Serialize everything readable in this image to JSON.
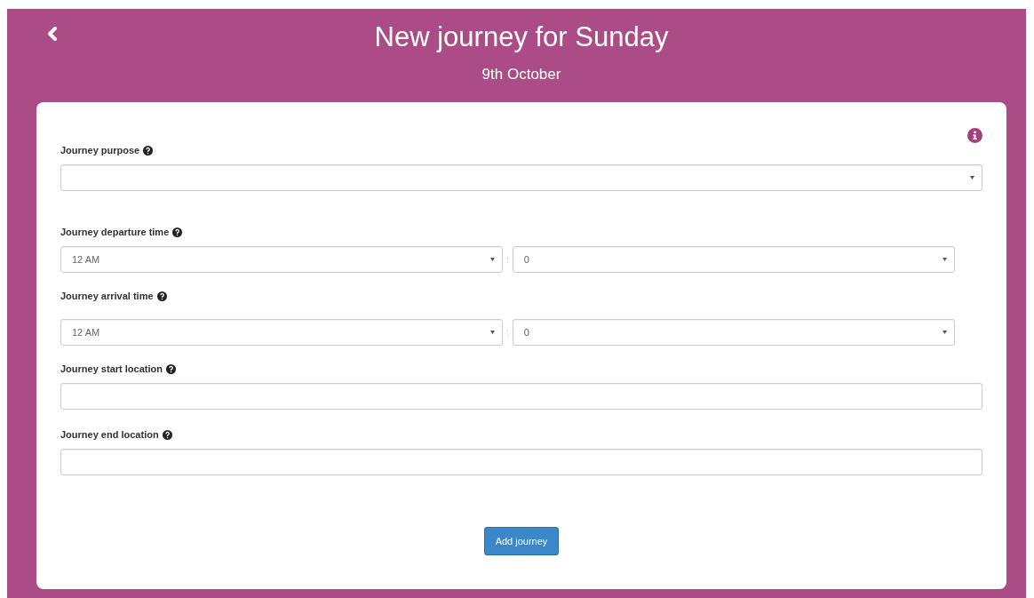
{
  "header": {
    "title": "New journey for Sunday",
    "subtitle": "9th October"
  },
  "fields": [
    {
      "kind": "select",
      "label": "Journey purpose"
    },
    {
      "kind": "time",
      "label": "Journey departure time",
      "hour": "12 AM",
      "separator": ":",
      "minute": "0"
    },
    {
      "kind": "time",
      "label": "Journey arrival time",
      "hour": "12 AM",
      "separator": ":",
      "minute": "0"
    },
    {
      "kind": "text",
      "label": "Journey start location"
    },
    {
      "kind": "text",
      "label": "Journey end location"
    }
  ],
  "submit": {
    "label": "Add journey"
  }
}
